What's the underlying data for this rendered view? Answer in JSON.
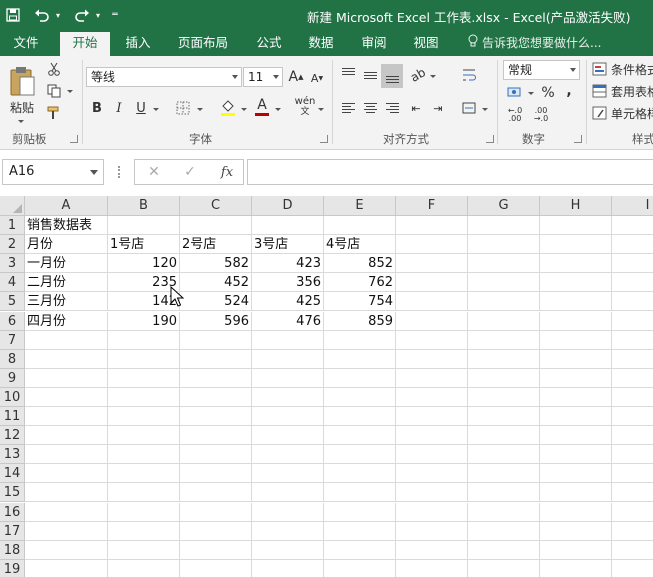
{
  "titlebar": {
    "title": "新建 Microsoft Excel 工作表.xlsx - Excel(产品激活失败)",
    "save_icon": "save-icon",
    "undo_icon": "undo-icon",
    "redo_icon": "redo-icon"
  },
  "tabs": [
    {
      "label": "文件"
    },
    {
      "label": "开始"
    },
    {
      "label": "插入"
    },
    {
      "label": "页面布局"
    },
    {
      "label": "公式"
    },
    {
      "label": "数据"
    },
    {
      "label": "审阅"
    },
    {
      "label": "视图"
    }
  ],
  "tellme": "告诉我您想要做什么...",
  "ribbon": {
    "clipboard": {
      "paste_label": "粘贴",
      "group_label": "剪贴板"
    },
    "font": {
      "font_name": "等线",
      "font_size": "11",
      "bold": "B",
      "italic": "I",
      "underline": "U",
      "phonetic": "wén",
      "grow": "A",
      "shrink": "A",
      "group_label": "字体"
    },
    "alignment": {
      "group_label": "对齐方式"
    },
    "number": {
      "format": "常规",
      "percent": "%",
      "comma": ",",
      "group_label": "数字"
    },
    "styles": {
      "conditional": "条件格式",
      "table": "套用表格",
      "cell": "单元格样",
      "group_label": "样式"
    }
  },
  "formula_bar": {
    "name_box": "A16",
    "cancel": "✕",
    "enter": "✓",
    "fx": "fx",
    "value": ""
  },
  "sheet": {
    "columns": [
      "A",
      "B",
      "C",
      "D",
      "E",
      "F",
      "G",
      "H",
      "I"
    ],
    "rows": [
      "1",
      "2",
      "3",
      "4",
      "5",
      "6",
      "7",
      "8",
      "9",
      "10",
      "11",
      "12",
      "13",
      "14",
      "15",
      "16",
      "17",
      "18",
      "19"
    ],
    "cells": {
      "title": "销售数据表",
      "header": [
        "月份",
        "1号店",
        "2号店",
        "3号店",
        "4号店"
      ],
      "data": [
        [
          "一月份",
          "120",
          "582",
          "423",
          "852"
        ],
        [
          "二月份",
          "235",
          "452",
          "356",
          "762"
        ],
        [
          "三月份",
          "142",
          "524",
          "425",
          "754"
        ],
        [
          "四月份",
          "190",
          "596",
          "476",
          "859"
        ]
      ]
    }
  }
}
